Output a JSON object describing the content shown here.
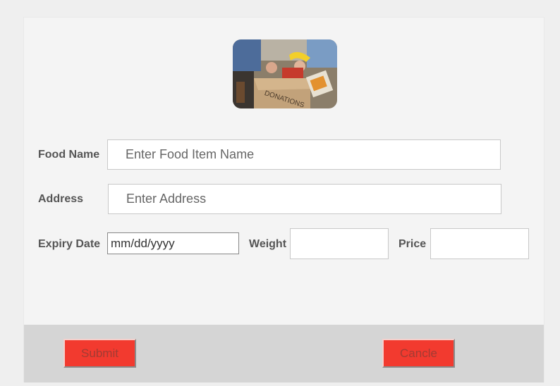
{
  "form": {
    "photo_alt": "Donations box with food items",
    "photo_box_text": "DONATIONS",
    "food_name": {
      "label": "Food Name",
      "placeholder": "Enter Food Item Name",
      "value": ""
    },
    "address": {
      "label": "Address",
      "placeholder": "Enter Address",
      "value": ""
    },
    "expiry_date": {
      "label": "Expiry Date",
      "placeholder": "mm/dd/yyyy",
      "value": ""
    },
    "weight": {
      "label": "Weight",
      "value": ""
    },
    "price": {
      "label": "Price",
      "value": ""
    }
  },
  "actions": {
    "submit_label": "Submit",
    "cancel_label": "Cancle"
  },
  "colors": {
    "button_bg": "#f23a2f",
    "button_text": "#a33b33",
    "footer_bg": "#d5d5d5",
    "card_bg": "#f4f4f4"
  }
}
